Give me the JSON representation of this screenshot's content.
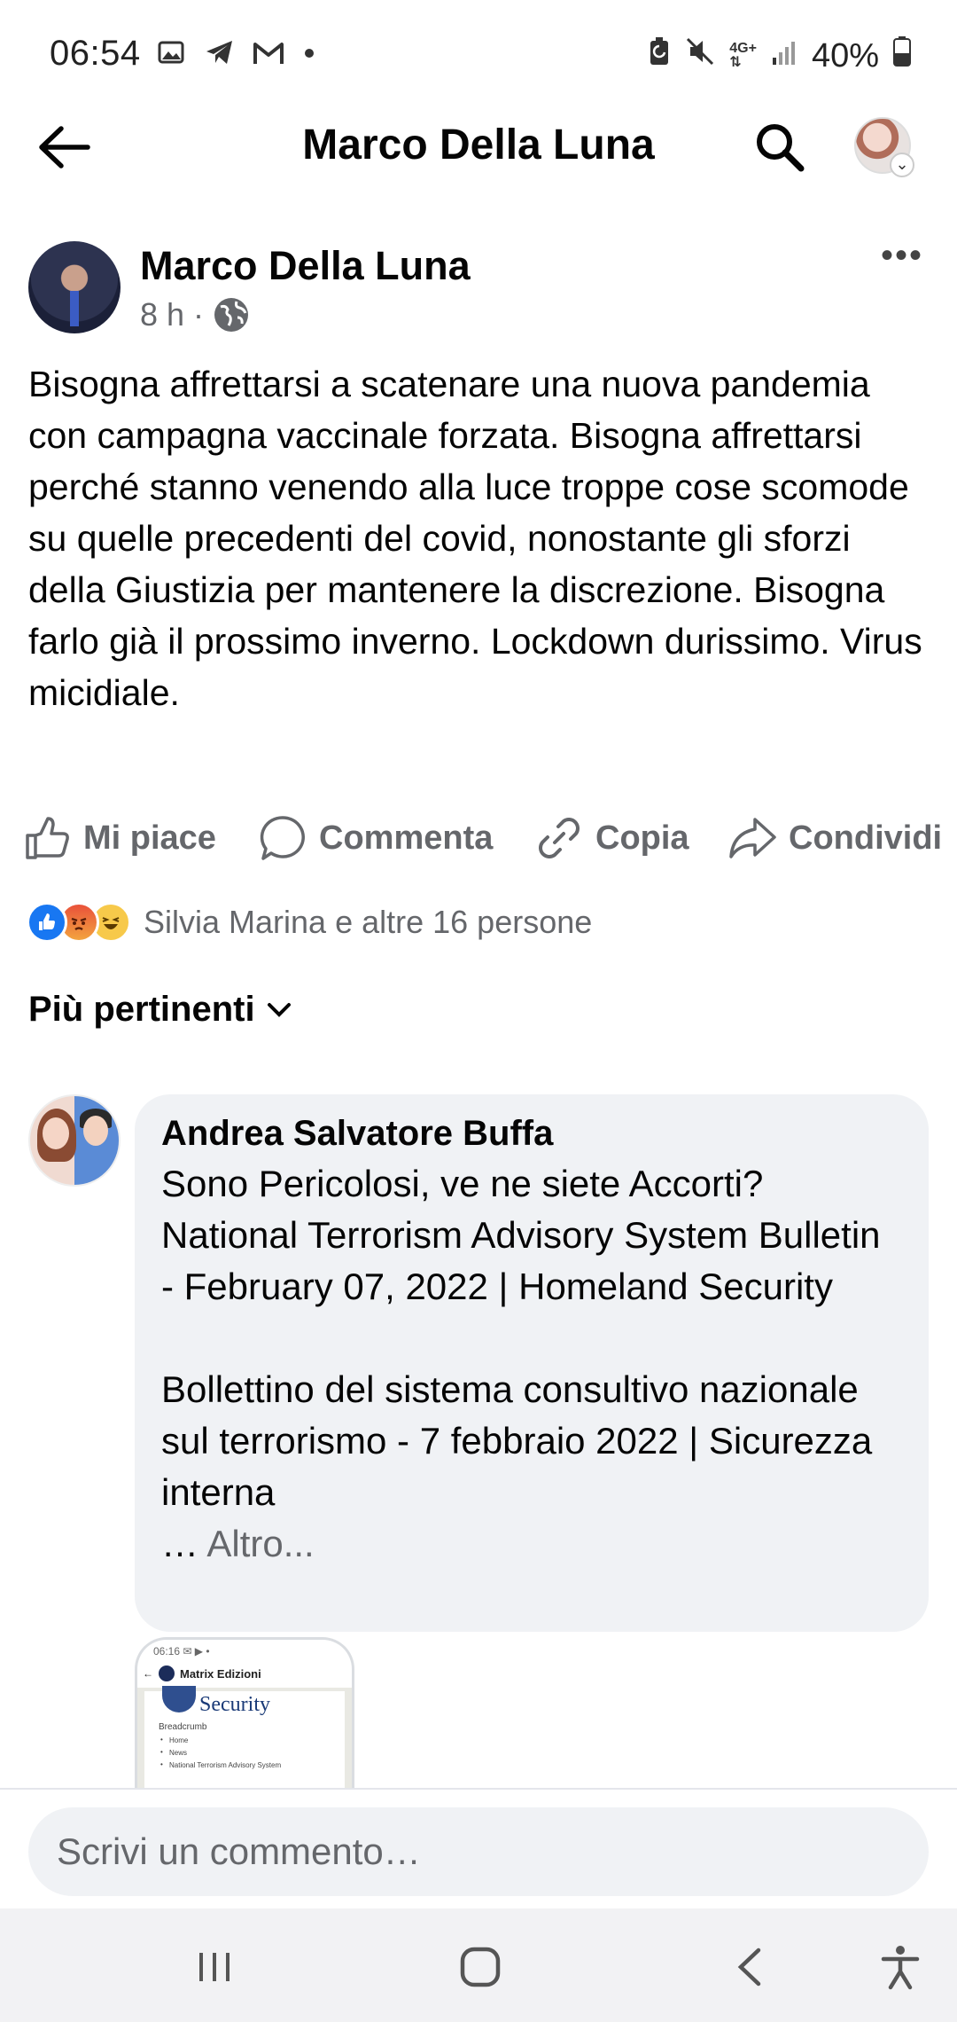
{
  "status_bar": {
    "time": "06:54",
    "battery": "40%",
    "network": "4G+",
    "left_icons": [
      "image-icon",
      "telegram-icon",
      "gmail-icon",
      "dot-icon"
    ],
    "right_icons": [
      "battery-saver-icon",
      "mute-icon",
      "network-4g-icon",
      "signal-icon",
      "battery-icon"
    ]
  },
  "header": {
    "title": "Marco Della Luna"
  },
  "post": {
    "author": "Marco Della Luna",
    "time": "8 h",
    "separator": "·",
    "visibility_icon": "globe-icon",
    "text": "Bisogna affrettarsi a scatenare una nuova pandemia con campagna vaccinale forzata. Bisogna affrettarsi perché stanno venendo alla luce troppe cose scomode su quelle precedenti del covid, nonostante gli sforzi della Giustizia per mantenere la discrezione. Bisogna farlo già il prossimo inverno. Lockdown durissimo. Virus micidiale."
  },
  "actions": {
    "like": "Mi piace",
    "comment": "Commenta",
    "copy": "Copia",
    "share": "Condividi"
  },
  "reactions": {
    "types": [
      "like",
      "angry",
      "haha"
    ],
    "summary": "Silvia Marina e altre 16 persone"
  },
  "sort": {
    "label": "Più pertinenti"
  },
  "comment": {
    "author": "Andrea Salvatore Buffa",
    "paragraph1": "Sono Pericolosi, ve ne siete Accorti? National Terrorism Advisory System Bulletin - February 07, 2022 | Homeland Security",
    "paragraph2": "Bollettino del sistema consultivo nazionale sul terrorismo - 7 febbraio 2022 | Sicurezza interna",
    "more_prefix": "… ",
    "more": "Altro...",
    "attachment": {
      "status": "06:16 ✉ ▶ •",
      "page_name": "Matrix Edizioni",
      "title": "Security",
      "section": "Breadcrumb",
      "items": [
        "Home",
        "News",
        "National Terrorism Advisory System"
      ]
    }
  },
  "input": {
    "placeholder": "Scrivi un commento…"
  },
  "nav": {
    "buttons": [
      "recent-apps-icon",
      "home-icon",
      "back-icon",
      "accessibility-icon"
    ]
  },
  "colors": {
    "accent": "#1877f2",
    "secondary_text": "#65676b",
    "bubble": "#f0f2f5"
  }
}
